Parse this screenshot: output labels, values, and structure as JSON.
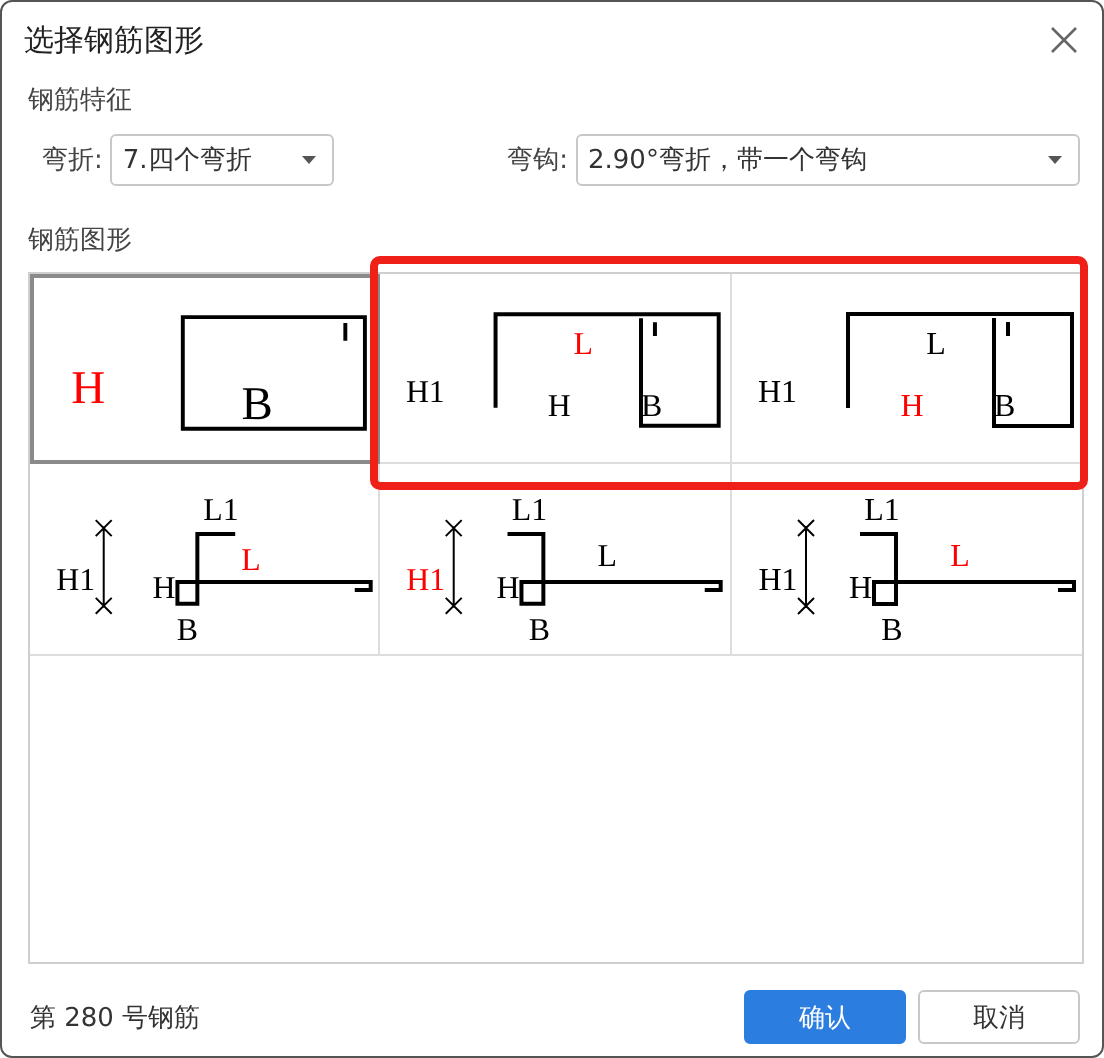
{
  "window": {
    "title": "选择钢筋图形"
  },
  "features": {
    "heading": "钢筋特征",
    "fields": [
      {
        "label": "弯折:",
        "value": "7.四个弯折"
      },
      {
        "label": "弯钩:",
        "value": "2.90°弯折，带一个弯钩"
      }
    ]
  },
  "shapes": {
    "heading": "钢筋图形",
    "cells": [
      {
        "kind": "closed-loop",
        "selected": true,
        "marked": false,
        "labels": [
          {
            "text": "H",
            "highlighted": true
          },
          {
            "text": "B",
            "highlighted": false
          }
        ]
      },
      {
        "kind": "channel",
        "selected": false,
        "marked": true,
        "labels": [
          {
            "text": "H1",
            "highlighted": false
          },
          {
            "text": "L",
            "highlighted": true
          },
          {
            "text": "H",
            "highlighted": false
          },
          {
            "text": "B",
            "highlighted": false
          }
        ]
      },
      {
        "kind": "channel",
        "selected": false,
        "marked": true,
        "labels": [
          {
            "text": "H1",
            "highlighted": false
          },
          {
            "text": "L",
            "highlighted": false
          },
          {
            "text": "H",
            "highlighted": true
          },
          {
            "text": "B",
            "highlighted": false
          }
        ]
      },
      {
        "kind": "hook-up",
        "selected": false,
        "marked": false,
        "labels": [
          {
            "text": "H1",
            "highlighted": false
          },
          {
            "text": "L1",
            "highlighted": false
          },
          {
            "text": "L",
            "highlighted": true
          },
          {
            "text": "H",
            "highlighted": false
          },
          {
            "text": "B",
            "highlighted": false
          }
        ]
      },
      {
        "kind": "hook-back",
        "selected": false,
        "marked": false,
        "labels": [
          {
            "text": "H1",
            "highlighted": true
          },
          {
            "text": "L1",
            "highlighted": false
          },
          {
            "text": "L",
            "highlighted": false
          },
          {
            "text": "H",
            "highlighted": false
          },
          {
            "text": "B",
            "highlighted": false
          }
        ]
      },
      {
        "kind": "hook-back",
        "selected": false,
        "marked": false,
        "labels": [
          {
            "text": "H1",
            "highlighted": false
          },
          {
            "text": "L1",
            "highlighted": false
          },
          {
            "text": "L",
            "highlighted": true
          },
          {
            "text": "H",
            "highlighted": false
          },
          {
            "text": "B",
            "highlighted": false
          }
        ]
      }
    ]
  },
  "status": "第 280 号钢筋",
  "buttons": [
    {
      "label": "确认",
      "kind": "primary"
    },
    {
      "label": "取消",
      "kind": "secondary"
    }
  ]
}
